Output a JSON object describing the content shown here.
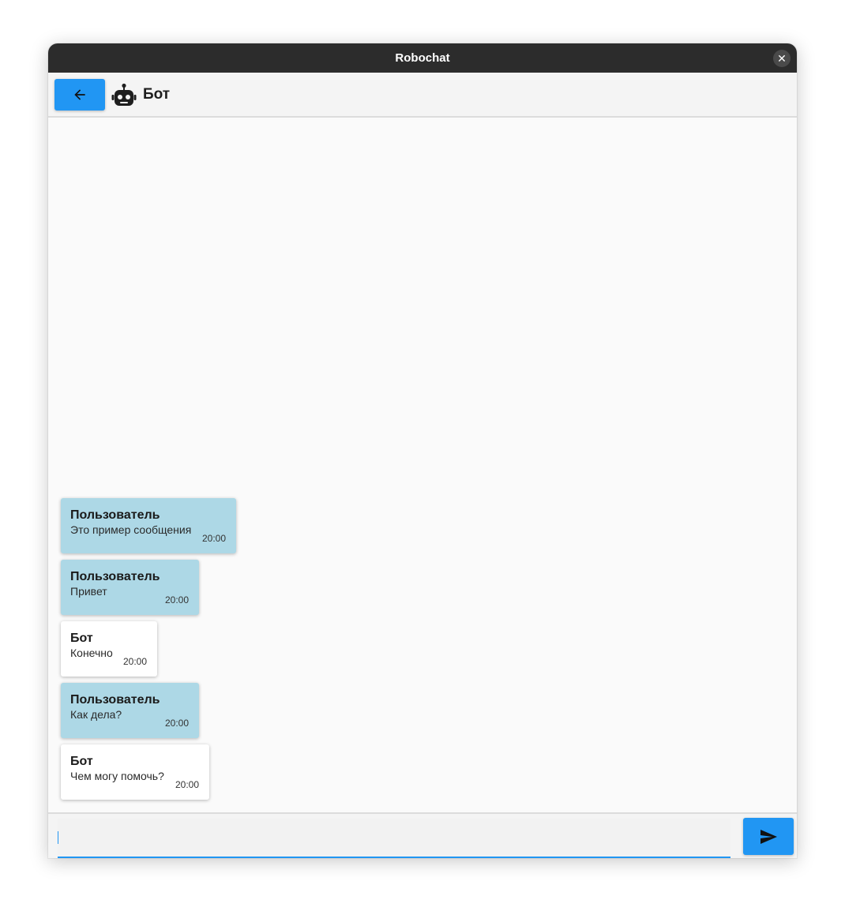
{
  "window": {
    "title": "Robochat",
    "close_glyph": "✕"
  },
  "header": {
    "back_icon": "arrow-left-icon",
    "avatar_icon": "robot-icon",
    "chat_name": "Бот"
  },
  "messages": [
    {
      "role": "user",
      "author": "Пользователь",
      "text": "Это пример сообщения",
      "time": "20:00"
    },
    {
      "role": "user",
      "author": "Пользователь",
      "text": "Привет",
      "time": "20:00"
    },
    {
      "role": "bot",
      "author": "Бот",
      "text": "Конечно",
      "time": "20:00"
    },
    {
      "role": "user",
      "author": "Пользователь",
      "text": "Как дела?",
      "time": "20:00"
    },
    {
      "role": "bot",
      "author": "Бот",
      "text": "Чем могу помочь?",
      "time": "20:00"
    }
  ],
  "composer": {
    "value": "",
    "placeholder": "",
    "send_icon": "send-icon"
  },
  "colors": {
    "accent": "#2196f3",
    "user_bubble": "#add8e6",
    "bot_bubble": "#ffffff",
    "titlebar": "#2c2c2c"
  }
}
